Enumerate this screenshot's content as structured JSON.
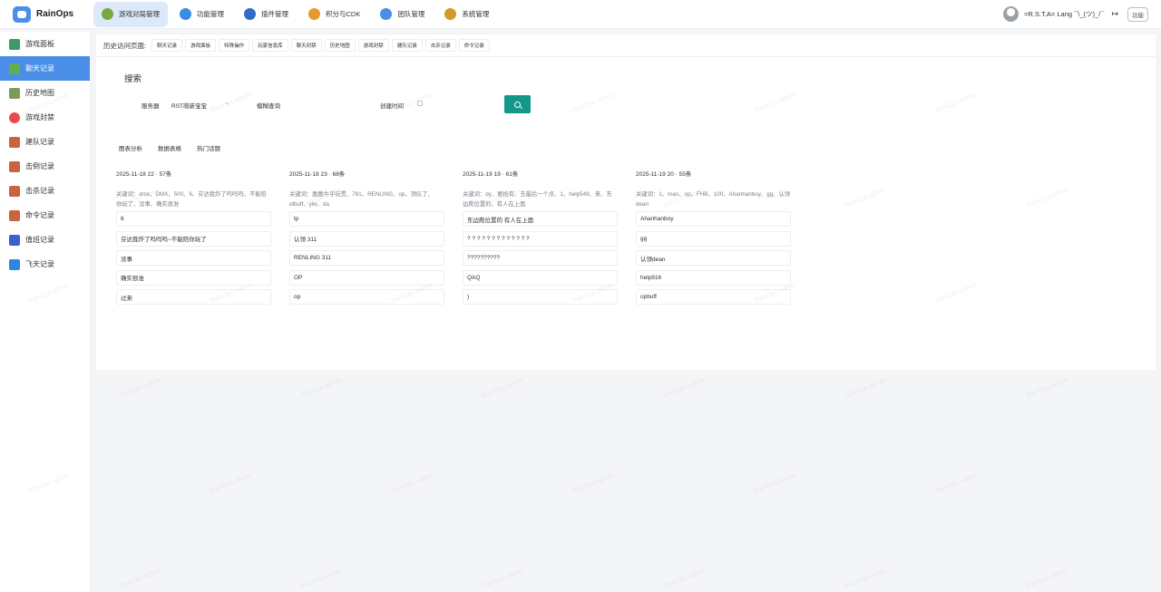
{
  "brand": {
    "name": "RainOps"
  },
  "topnav": [
    {
      "label": "游戏对局管理",
      "icon": "game-icon",
      "color": "#7aa843",
      "active": true
    },
    {
      "label": "功能管理",
      "icon": "gear-icon",
      "color": "#3c8be6",
      "active": false
    },
    {
      "label": "插件管理",
      "icon": "plugin-icon",
      "color": "#2e6cc9",
      "active": false
    },
    {
      "label": "积分与CDK",
      "icon": "coin-icon",
      "color": "#e79a2b",
      "active": false
    },
    {
      "label": "团队管理",
      "icon": "team-icon",
      "color": "#4a8ee8",
      "active": false
    },
    {
      "label": "系统管理",
      "icon": "tools-icon",
      "color": "#d49a28",
      "active": false
    }
  ],
  "user": {
    "name": "=R.S.T.A= Lang ¯\\_(ツ)_/¯",
    "function_button": "功能"
  },
  "sidebar": [
    {
      "label": "游戏面板",
      "icon": "table-icon",
      "color": "#3a9a6a",
      "active": false
    },
    {
      "label": "聊天记录",
      "icon": "chat-icon",
      "color": "#5fae4f",
      "active": true
    },
    {
      "label": "历史地图",
      "icon": "map-icon",
      "color": "#7c9a5a",
      "active": false
    },
    {
      "label": "游戏封禁",
      "icon": "ban-icon",
      "color": "#e94b4b",
      "active": false
    },
    {
      "label": "建队记录",
      "icon": "note-icon",
      "color": "#c8643f",
      "active": false
    },
    {
      "label": "击倒记录",
      "icon": "note-icon",
      "color": "#c8643f",
      "active": false
    },
    {
      "label": "击杀记录",
      "icon": "note-icon",
      "color": "#c8643f",
      "active": false
    },
    {
      "label": "命令记录",
      "icon": "note-icon",
      "color": "#c8643f",
      "active": false
    },
    {
      "label": "值班记录",
      "icon": "duty-icon",
      "color": "#3b5fd0",
      "active": false
    },
    {
      "label": "飞天记录",
      "icon": "camera-icon",
      "color": "#2f86e0",
      "active": false
    }
  ],
  "history": {
    "label": "历史访问页面:",
    "chips": [
      "聊天记录",
      "游戏面板",
      "特殊操作",
      "玩家信息库",
      "聊天封禁",
      "历史地图",
      "游戏封禁",
      "建队记录",
      "击杀记录",
      "命令记录"
    ]
  },
  "search": {
    "title": "搜索",
    "server_label": "服务器",
    "server_value": "RST萌新宝宝",
    "fuzzy_label": "模糊查询",
    "created_label": "创建时间"
  },
  "tabs": [
    "图表分析",
    "数据表格",
    "热门话题"
  ],
  "columns": [
    {
      "header": "2025-11-18 22 · 57条",
      "keywords": "关键词：dmx、DMX、500、6、芬达我炸了吗吗吗、不能陪你玩了、没事、确实很准",
      "messages": [
        "6",
        "芬达我炸了吗吗吗~不能陪你玩了",
        "没事",
        "确实很准",
        "过来"
      ]
    },
    {
      "header": "2025-11-18 23 · 68条",
      "keywords": "关键词：脆脆牛乎玩贯、781、RENLING、op、顶队了、idbuff、yiw、da",
      "messages": [
        "tp",
        "认领 311",
        "RENLING 311",
        "OP",
        "op"
      ]
    },
    {
      "header": "2025-11-19 19 · 61条",
      "keywords": "关键词：dy、要抢有、去最后一个点、1、help549、来、东边爬位置的、有人在上面",
      "messages": [
        "东边爬位置的 有人在上面",
        "? ? ? ? ? ? ? ? ? ? ? ? ?",
        "??????????",
        "QAQ",
        ")"
      ]
    },
    {
      "header": "2025-11-19 20 · 55条",
      "keywords": "关键词：1、man、op、FHB、100、Ahanhanboy、gg、认领dean",
      "messages": [
        "Ahanhanboy",
        "gg",
        "认领dean",
        "help916",
        "opbuff"
      ]
    }
  ],
  "watermark": "RainOps admin"
}
